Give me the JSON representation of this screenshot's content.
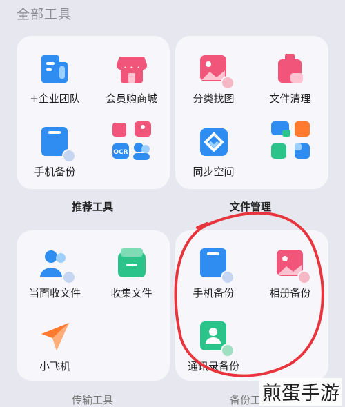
{
  "header": {
    "title": "全部工具"
  },
  "groups": [
    {
      "title": "推荐工具",
      "tools": [
        {
          "label": "+企业团队",
          "icon": "enterprise-team-icon"
        },
        {
          "label": "会员购商城",
          "icon": "shop-icon"
        },
        {
          "label": "手机备份",
          "icon": "phone-backup-icon"
        },
        {
          "label": "",
          "icon": "mini-grid-icon"
        }
      ]
    },
    {
      "title": "文件管理",
      "tools": [
        {
          "label": "分类找图",
          "icon": "photo-search-icon"
        },
        {
          "label": "文件清理",
          "icon": "file-clean-icon"
        },
        {
          "label": "同步空间",
          "icon": "sync-space-icon"
        },
        {
          "label": "",
          "icon": "mini-grid-icon"
        }
      ]
    },
    {
      "title": "传输工具",
      "tools": [
        {
          "label": "当面收文件",
          "icon": "face-to-face-icon"
        },
        {
          "label": "收集文件",
          "icon": "collect-files-icon"
        },
        {
          "label": "小飞机",
          "icon": "paper-plane-icon"
        }
      ]
    },
    {
      "title": "备份工具",
      "tools": [
        {
          "label": "手机备份",
          "icon": "phone-backup-icon"
        },
        {
          "label": "相册备份",
          "icon": "album-backup-icon"
        },
        {
          "label": "通讯录备份",
          "icon": "contacts-backup-icon"
        }
      ]
    }
  ],
  "mini_icons": {
    "ocr_text": "OCR"
  },
  "watermark": "煎蛋手游",
  "colors": {
    "background": "#e6e7ef",
    "card": "#f7f7fb",
    "blue": "#2f8cf0",
    "pink": "#f2557a",
    "green": "#2cc38b",
    "orange": "#ff7a2e",
    "annotation_red": "#e8343c"
  }
}
